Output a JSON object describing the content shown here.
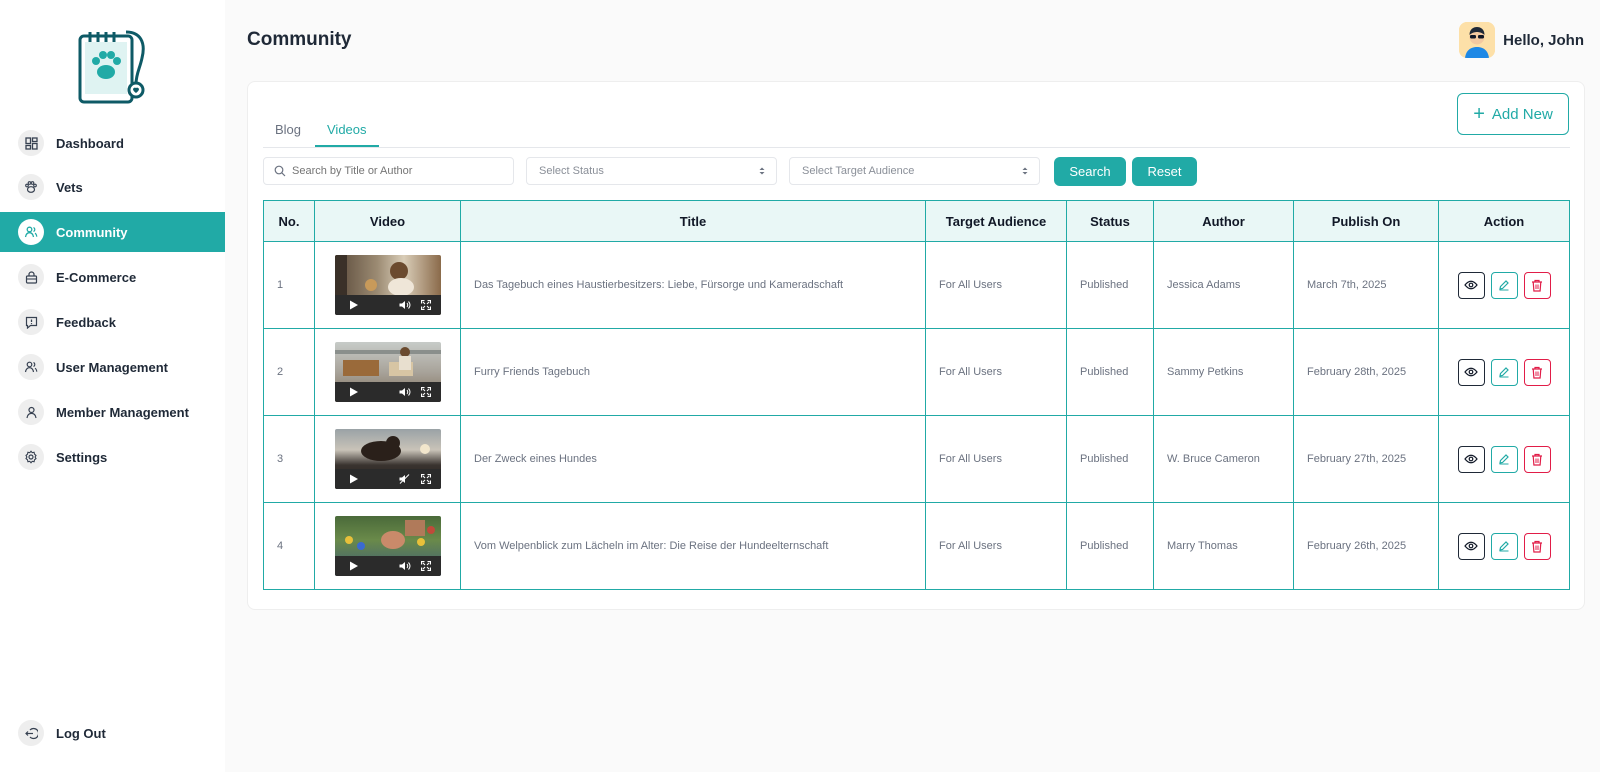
{
  "header": {
    "title": "Community",
    "greeting": "Hello, John"
  },
  "sidebar": {
    "items": [
      {
        "label": "Dashboard",
        "icon": "dashboard-icon"
      },
      {
        "label": "Vets",
        "icon": "paw-icon"
      },
      {
        "label": "Community",
        "icon": "community-icon",
        "active": true
      },
      {
        "label": "E-Commerce",
        "icon": "shopping-bag-icon"
      },
      {
        "label": "Feedback",
        "icon": "feedback-icon"
      },
      {
        "label": "User Management",
        "icon": "users-icon"
      },
      {
        "label": "Member Management",
        "icon": "member-icon"
      },
      {
        "label": "Settings",
        "icon": "gear-icon"
      }
    ],
    "logout": "Log Out"
  },
  "toolbar": {
    "add_new": "Add New"
  },
  "tabs": [
    {
      "label": "Blog"
    },
    {
      "label": "Videos",
      "active": true
    }
  ],
  "filters": {
    "search_placeholder": "Search by Title or Author",
    "status_placeholder": "Select Status",
    "audience_placeholder": "Select Target Audience",
    "search_button": "Search",
    "reset_button": "Reset"
  },
  "table": {
    "columns": [
      "No.",
      "Video",
      "Title",
      "Target Audience",
      "Status",
      "Author",
      "Publish On",
      "Action"
    ],
    "rows": [
      {
        "no": "1",
        "title": "Das Tagebuch eines Haustierbesitzers: Liebe, Fürsorge und Kameradschaft",
        "audience": "For All Users",
        "status": "Published",
        "author": "Jessica Adams",
        "date": "March 7th, 2025"
      },
      {
        "no": "2",
        "title": "Furry Friends Tagebuch",
        "audience": "For All Users",
        "status": "Published",
        "author": "Sammy Petkins",
        "date": "February 28th, 2025"
      },
      {
        "no": "3",
        "title": "Der Zweck eines Hundes",
        "audience": "For All Users",
        "status": "Published",
        "author": "W. Bruce Cameron",
        "date": "February 27th, 2025"
      },
      {
        "no": "4",
        "title": "Vom Welpenblick zum Lächeln im Alter: Die Reise der Hundeelternschaft",
        "audience": "For All Users",
        "status": "Published",
        "author": "Marry Thomas",
        "date": "February 26th, 2025"
      }
    ]
  },
  "colors": {
    "accent": "#21aaa6",
    "danger": "#e11d48",
    "header_bg": "#e9f7f6"
  }
}
